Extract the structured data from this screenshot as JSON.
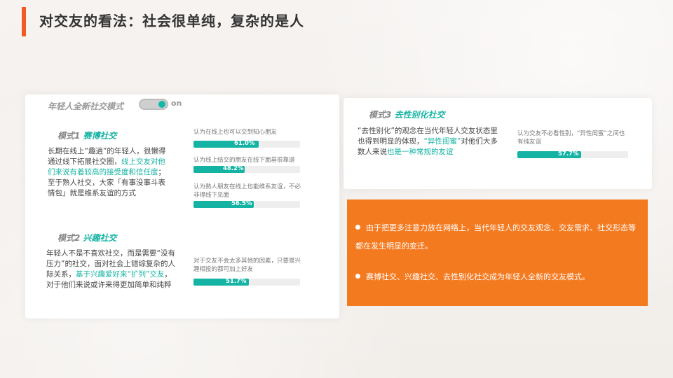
{
  "page": {
    "title": "对交友的看法：社会很单纯，复杂的是人",
    "accent": "#f15a22"
  },
  "left_card": {
    "header": "年轻人全新社交模式",
    "toggle_label": "on",
    "toggle_color": "#12b8a6",
    "modes": [
      {
        "prefix": "模式1",
        "name": "赛博社交",
        "text_parts": [
          {
            "t": "长期在线上“趣逍”的年轻人，很懒得通过线下拓展社交圈，",
            "hl": false
          },
          {
            "t": "线上交友对他们来说有着较高的接受度和信任度",
            "hl": true
          },
          {
            "t": "；至于熟人社交，大家「有事没事斗表情包」就是维系友谊的方式",
            "hl": false
          }
        ],
        "stats": [
          {
            "caption": "认为在线上也可以交到知心朋友",
            "value": 61.0,
            "label": "61.0%"
          },
          {
            "caption": "认为线上结交的朋友在线下面基很靠谱",
            "value": 48.2,
            "label": "48.2%"
          },
          {
            "caption": "认为熟人朋友在线上也能维系友谊，不必非得线下见面",
            "value": 56.5,
            "label": "56.5%"
          }
        ]
      },
      {
        "prefix": "模式2",
        "name": "兴趣社交",
        "text_parts": [
          {
            "t": "年轻人不是不喜欢社交，而是需要“没有压力”的社交，面对社会上错综复杂的人际关系，",
            "hl": false
          },
          {
            "t": "基于兴趣爱好来“扩列”交友",
            "hl": true
          },
          {
            "t": "，对于他们来说或许来得更加简单和纯粹",
            "hl": false
          }
        ],
        "stats": [
          {
            "caption": "对于交友不会太多其他的因素，只要是兴趣相投的都可加上好友",
            "value": 51.7,
            "label": "51.7%"
          }
        ]
      }
    ]
  },
  "right_top_card": {
    "prefix": "模式3",
    "name": "去性别化社交",
    "text_parts": [
      {
        "t": "“去性别化”的观念在当代年轻人交友状态里也得到明显的体现，",
        "hl": false
      },
      {
        "t": "“异性闺蜜”",
        "hl": true
      },
      {
        "t": "对他们大多数人来说",
        "hl": false
      },
      {
        "t": "也是一种常规的友谊",
        "hl": true
      }
    ],
    "stat": {
      "caption": "认为交友不必看性别，“异性闺蜜”之间也有纯友谊",
      "value": 57.7,
      "label": "57.7%"
    }
  },
  "orange_card": {
    "background": "#f47a20",
    "bullets": [
      "由于把更多注意力放在网络上，当代年轻人的交友观念、交友需求、社交形态等都在发生明显的变迁。",
      "赛博社交、兴趣社交、去性别化社交成为年轻人全新的交友模式。"
    ]
  }
}
